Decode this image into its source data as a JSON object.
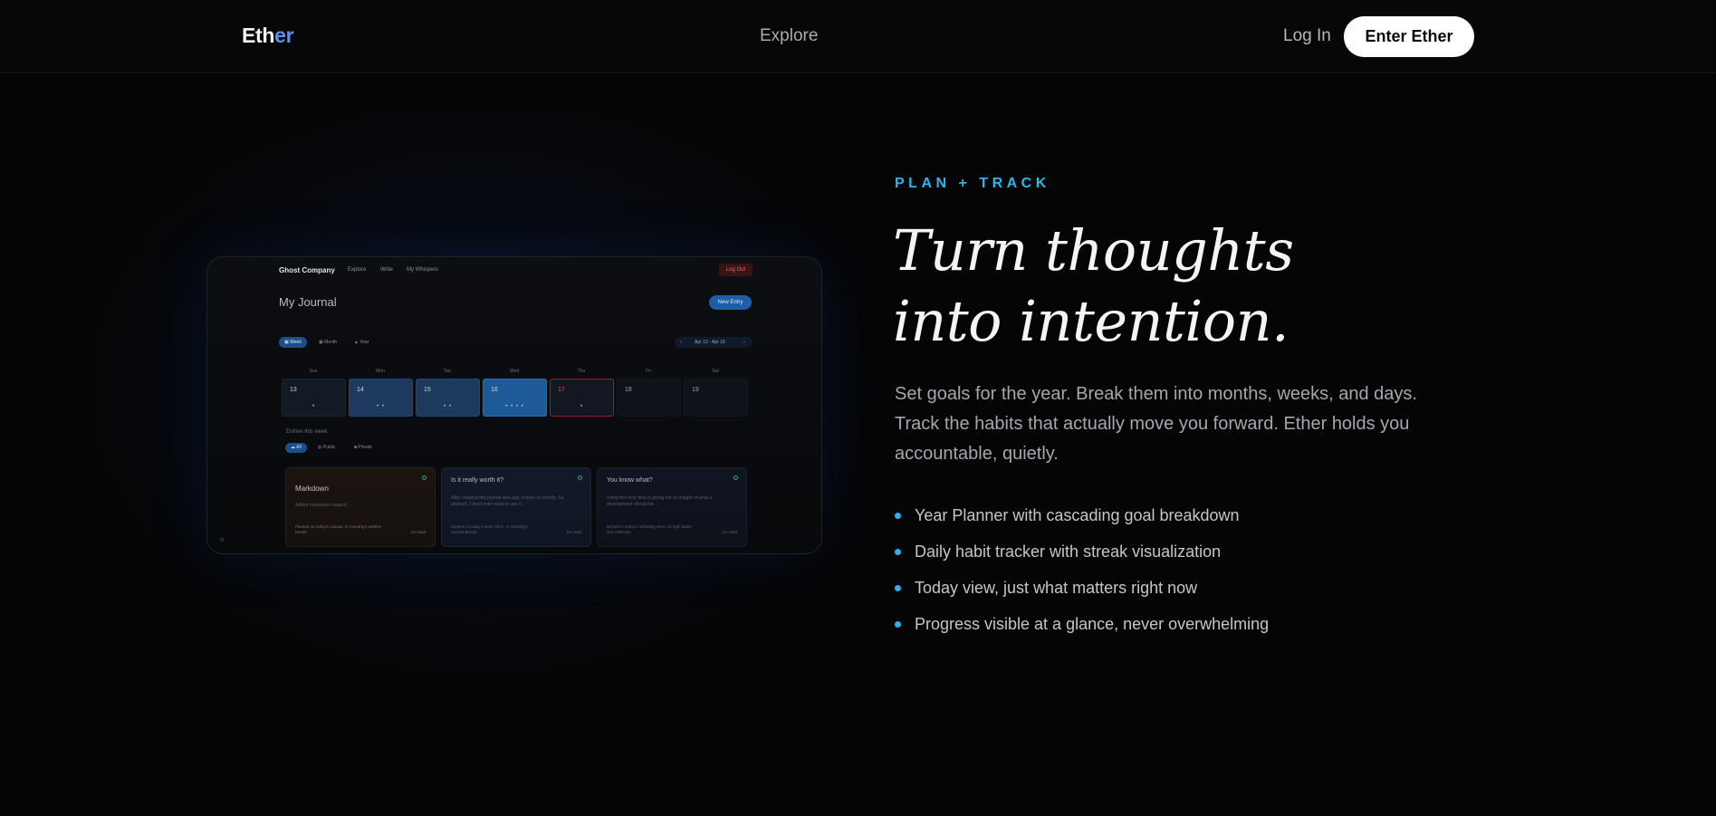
{
  "nav": {
    "logo_main": "Eth",
    "logo_accent": "er",
    "explore": "Explore",
    "login": "Log In",
    "cta": "Enter Ether"
  },
  "colors": {
    "accent": "#2bb3ec",
    "logo_accent": "#5b8ef7",
    "background": "#050506"
  },
  "mockup": {
    "brand": "Ghost Company",
    "nav_items": [
      "Explore",
      "Write",
      "My Whispers"
    ],
    "logout": "Log Out",
    "title": "My Journal",
    "new_entry": "New Entry",
    "view_tabs": [
      "Week",
      "Month",
      "Year"
    ],
    "active_view": "Week",
    "range_prev": "‹",
    "range_label": "Apr 13 - Apr 18",
    "range_next": "›",
    "weekdays": [
      "Sun",
      "Mon",
      "Tue",
      "Wed",
      "Thu",
      "Fri",
      "Sat"
    ],
    "days": [
      {
        "num": "13",
        "dots": "•"
      },
      {
        "num": "14",
        "dots": "• •"
      },
      {
        "num": "15",
        "dots": "• •"
      },
      {
        "num": "16",
        "dots": "• • • •"
      },
      {
        "num": "17",
        "dots": "•"
      },
      {
        "num": "18",
        "dots": ""
      },
      {
        "num": "19",
        "dots": ""
      }
    ],
    "entries_heading": "Entries this week",
    "filters": [
      "All",
      "Public",
      "Private"
    ],
    "cards": [
      {
        "title": "Markdown",
        "body": "Added markdown support...",
        "foot": "Painted on today's canvas. In morning's earliest breath",
        "read": "1m read"
      },
      {
        "title": "Is it really worth it?",
        "body": "After creating this journal web app, it feels so moody. So abstract, I don't even want to use it...",
        "foot": "Spoken in today's quiet voice. In morning's second breath",
        "read": "1m read"
      },
      {
        "title": "You know what?",
        "body": "Using this over time is giving me an insight of what a development should be...",
        "foot": "Etched in today's unfolding story. As light fades into reflection",
        "read": "1m read"
      }
    ],
    "corner": "N"
  },
  "hero": {
    "eyebrow": "PLAN + TRACK",
    "headline_line1": "Turn thoughts",
    "headline_line2": "into intention.",
    "lead": "Set goals for the year. Break them into months, weeks, and days. Track the habits that actually move you forward. Ether holds you accountable, quietly.",
    "features": [
      "Year Planner with cascading goal breakdown",
      "Daily habit tracker with streak visualization",
      "Today view, just what matters right now",
      "Progress visible at a glance, never overwhelming"
    ]
  }
}
